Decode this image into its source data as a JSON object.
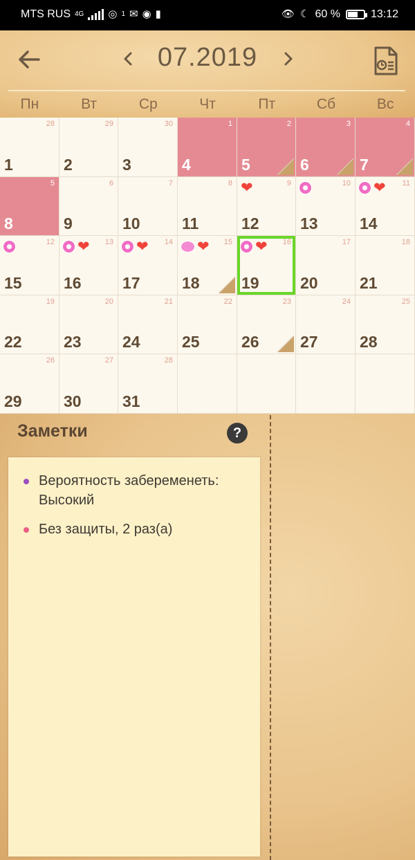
{
  "status_bar": {
    "carrier": "MTS RUS",
    "net": "4G",
    "hotspot_badge": "1",
    "battery": "60 %",
    "time": "13:12"
  },
  "header": {
    "title": "07.2019",
    "weekdays": [
      "Пн",
      "Вт",
      "Ср",
      "Чт",
      "Пт",
      "Сб",
      "Вс"
    ]
  },
  "calendar": {
    "rows": [
      [
        {
          "day": "1",
          "sub": "28"
        },
        {
          "day": "2",
          "sub": "29"
        },
        {
          "day": "3",
          "sub": "30"
        },
        {
          "day": "4",
          "sub": "1",
          "period": true
        },
        {
          "day": "5",
          "sub": "2",
          "period": true,
          "note": true
        },
        {
          "day": "6",
          "sub": "3",
          "period": true,
          "note": true
        },
        {
          "day": "7",
          "sub": "4",
          "period": true,
          "note": true
        }
      ],
      [
        {
          "day": "8",
          "sub": "5",
          "period": true
        },
        {
          "day": "9",
          "sub": "6"
        },
        {
          "day": "10",
          "sub": "7"
        },
        {
          "day": "11",
          "sub": "8"
        },
        {
          "day": "12",
          "sub": "9",
          "icons": [
            "heart"
          ]
        },
        {
          "day": "13",
          "sub": "10",
          "icons": [
            "flower"
          ]
        },
        {
          "day": "14",
          "sub": "11",
          "icons": [
            "flower",
            "heart"
          ]
        }
      ],
      [
        {
          "day": "15",
          "sub": "12",
          "icons": [
            "flower"
          ]
        },
        {
          "day": "16",
          "sub": "13",
          "icons": [
            "flower",
            "heart"
          ]
        },
        {
          "day": "17",
          "sub": "14",
          "icons": [
            "flower",
            "heart"
          ]
        },
        {
          "day": "18",
          "sub": "15",
          "icons": [
            "bubble",
            "heart"
          ],
          "note": true
        },
        {
          "day": "19",
          "sub": "16",
          "icons": [
            "flower",
            "heart"
          ],
          "today": true
        },
        {
          "day": "20",
          "sub": "17"
        },
        {
          "day": "21",
          "sub": "18"
        }
      ],
      [
        {
          "day": "22",
          "sub": "19"
        },
        {
          "day": "23",
          "sub": "20"
        },
        {
          "day": "24",
          "sub": "21"
        },
        {
          "day": "25",
          "sub": "22"
        },
        {
          "day": "26",
          "sub": "23",
          "note": true
        },
        {
          "day": "27",
          "sub": "24"
        },
        {
          "day": "28",
          "sub": "25"
        }
      ],
      [
        {
          "day": "29",
          "sub": "26"
        },
        {
          "day": "30",
          "sub": "27"
        },
        {
          "day": "31",
          "sub": "28"
        },
        {
          "day": "",
          "sub": ""
        },
        {
          "day": "",
          "sub": ""
        },
        {
          "day": "",
          "sub": ""
        },
        {
          "day": "",
          "sub": ""
        }
      ]
    ],
    "colors": {
      "period": "#e58a93",
      "today_outline": "#6ad62a"
    }
  },
  "notes": {
    "title": "Заметки",
    "help": "?",
    "items": [
      {
        "lines": [
          "Вероятность забеременеть:",
          "Высокий"
        ],
        "color": "#9b4fc0"
      },
      {
        "lines": [
          "Без защиты, 2 раз(а)"
        ],
        "color": "#ee5f86"
      }
    ]
  }
}
